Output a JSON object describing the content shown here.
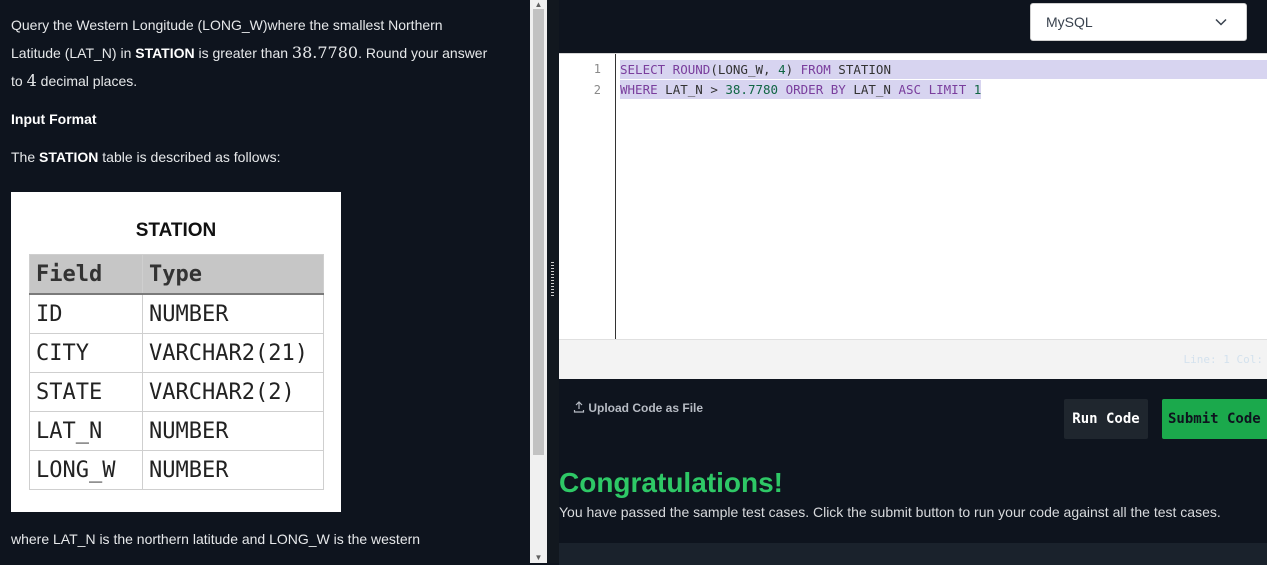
{
  "problem": {
    "line1": "Query the Western Longitude (LONG_W)where the smallest Northern",
    "line2_pre": "Latitude (LAT_N) in ",
    "line2_bold": "STATION",
    "line2_mid": " is greater than ",
    "line2_num": "38.7780",
    "line2_post": ". Round your answer",
    "line3_pre": "to ",
    "line3_num": "4",
    "line3_post": " decimal places.",
    "input_format_heading": "Input Format",
    "table_desc_pre": "The ",
    "table_desc_bold": "STATION",
    "table_desc_post": " table is described as follows:",
    "footer_line": "where LAT_N is the northern latitude and LONG_W is the western"
  },
  "station_table": {
    "caption": "STATION",
    "headers": [
      "Field",
      "Type"
    ],
    "rows": [
      [
        "ID",
        "NUMBER"
      ],
      [
        "CITY",
        "VARCHAR2(21)"
      ],
      [
        "STATE",
        "VARCHAR2(2)"
      ],
      [
        "LAT_N",
        "NUMBER"
      ],
      [
        "LONG_W",
        "NUMBER"
      ]
    ]
  },
  "language_select": {
    "value": "MySQL"
  },
  "editor": {
    "line_numbers": [
      "1",
      "2"
    ],
    "line1": {
      "t1": "SELECT",
      "t2": " ROUND",
      "t3": "(",
      "t4": "LONG_W, ",
      "t5": "4",
      "t6": ")",
      "t7": " FROM",
      "t8": " STATION"
    },
    "line2": {
      "t1": "WHERE",
      "t2": " LAT_N > ",
      "t3": "38.7780",
      "t4": " ORDER BY",
      "t5": " LAT_N ",
      "t6": "ASC",
      "t7": " LIMIT ",
      "t8": "1"
    }
  },
  "status_bar": {
    "text": "Line: 1 Col:"
  },
  "actions": {
    "upload_label": "Upload Code as File",
    "run_label": "Run Code",
    "submit_label": "Submit Code"
  },
  "result": {
    "title": "Congratulations!",
    "message": "You have passed the sample test cases. Click the submit button to run your code against all the test cases."
  },
  "colors": {
    "background": "#0e141e",
    "success_green": "#2ec866",
    "submit_green": "#1ba94c",
    "selection": "#d7d4f0"
  }
}
